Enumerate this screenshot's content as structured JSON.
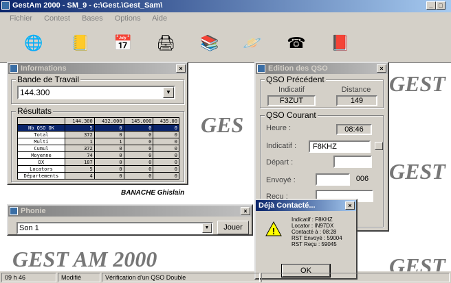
{
  "app": {
    "title": "GestAm 2000 - SM_9 - c:\\Gest.\\Gest_Sam\\"
  },
  "menu": [
    "Fichier",
    "Contest",
    "Bases",
    "Options",
    "Aide"
  ],
  "toolbar": {
    "icons": [
      "globe-icon",
      "notebook-icon",
      "calendar-icon",
      "printer-icon",
      "folder-stack-icon",
      "planet-icon",
      "phone-icon",
      "books-icon"
    ]
  },
  "background_text": {
    "gest": "GES",
    "gest_right": "GEST",
    "gestam": "GEST AM 2000",
    "name": "BANACHE Ghislain"
  },
  "info_window": {
    "title": "Informations",
    "band_label": "Bande de Travail",
    "band_value": "144.300",
    "results_label": "Résultats",
    "columns": [
      "",
      "144.300",
      "432.000",
      "145.000",
      "435.00"
    ],
    "rows": [
      [
        "Nb QSO OK",
        "5",
        "0",
        "0",
        "0"
      ],
      [
        "Total",
        "372",
        "0",
        "0",
        "0"
      ],
      [
        "Multi",
        "1",
        "1",
        "0",
        "0"
      ],
      [
        "Cumul",
        "372",
        "0",
        "0",
        "0"
      ],
      [
        "Moyenne",
        "74",
        "0",
        "0",
        "0"
      ],
      [
        "DX",
        "187",
        "0",
        "0",
        "0"
      ],
      [
        "Locators",
        "5",
        "0",
        "0",
        "0"
      ],
      [
        "Départements",
        "4",
        "0",
        "0",
        "0"
      ]
    ]
  },
  "qso_window": {
    "title": "Edition des QSO",
    "prev_label": "QSO Précédent",
    "prev_headers": [
      "Indicatif",
      "Distance"
    ],
    "prev_values": [
      "F3ZUT",
      "149"
    ],
    "current_label": "QSO Courant",
    "heure_label": "Heure :",
    "heure_value": "08:46",
    "indicatif_label": "Indicatif :",
    "indicatif_value": "F8KHZ",
    "depart_label": "Départ :",
    "envoye_label": "Envoyé :",
    "envoye_value": "006",
    "recu_label": "Reçu :"
  },
  "phonie_window": {
    "title": "Phonie",
    "select_value": "Son 1",
    "play_label": "Jouer"
  },
  "alert_dialog": {
    "title": "Déjà Contacté...",
    "lines": [
      "Indicatif : F8KHZ",
      "Locator : IN97DX",
      "Contacté à : 08:28",
      "RST Envoyé : 59004",
      "RST Reçu : 59045"
    ],
    "ok_label": "OK"
  },
  "status": {
    "time": "09 h 46",
    "mode": "Modifié",
    "message": "Vérification d'un QSO Double"
  }
}
